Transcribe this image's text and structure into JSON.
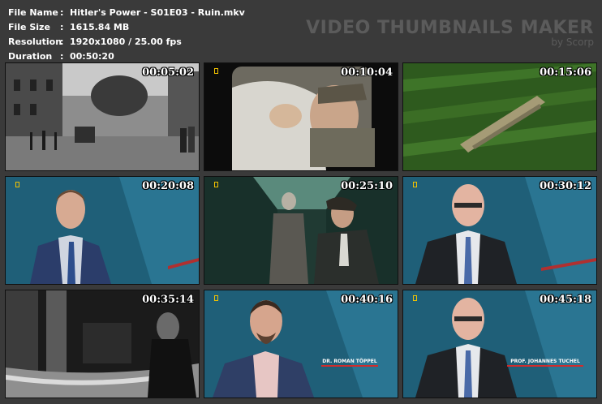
{
  "file_info": {
    "file_name_label": "File Name",
    "file_name_value": "Hitler's Power - S01E03 - Ruin.mkv",
    "file_size_label": "File Size",
    "file_size_value": "1615.84 MB",
    "resolution_label": "Resolution",
    "resolution_value": "1920x1080 / 25.00 fps",
    "duration_label": "Duration",
    "duration_value": "00:50:20",
    "separator": ":"
  },
  "brand": {
    "title": "VIDEO THUMBNAILS MAKER",
    "subtitle": "by Scorp"
  },
  "thumbnails": [
    {
      "timestamp": "00:05:02"
    },
    {
      "timestamp": "00:10:04"
    },
    {
      "timestamp": "00:15:06"
    },
    {
      "timestamp": "00:20:08"
    },
    {
      "timestamp": "00:25:10"
    },
    {
      "timestamp": "00:30:12"
    },
    {
      "timestamp": "00:35:14"
    },
    {
      "timestamp": "00:40:16",
      "caption_name": "DR. ROMAN TÖPPEL"
    },
    {
      "timestamp": "00:45:18",
      "caption_name": "PROF. JOHANNES TUCHEL"
    }
  ],
  "colors": {
    "background": "#3a3a3a",
    "brand_text": "#5b5b5b",
    "natgeo_yellow": "#f2c200",
    "caption_red": "#d02c2c"
  }
}
